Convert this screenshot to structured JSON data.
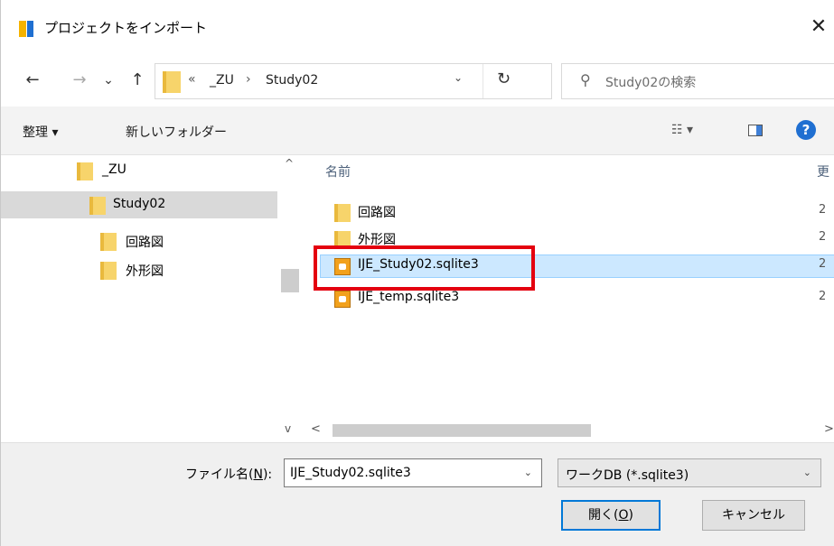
{
  "window": {
    "title": "プロジェクトをインポート",
    "close": "✕"
  },
  "nav": {
    "back": "←",
    "forward": "→",
    "recent": "⌄",
    "up": "↑"
  },
  "address": {
    "overflow": "«",
    "crumbs": [
      "_ZU",
      "Study02"
    ],
    "separator": "›",
    "dropdown": "⌄",
    "refresh": "↻"
  },
  "search": {
    "placeholder": "Study02の検索",
    "icon": "⚲"
  },
  "toolbar": {
    "organize": "整理 ▾",
    "new_folder": "新しいフォルダー",
    "view": "☷ ▾",
    "help": "?"
  },
  "tree": [
    {
      "label": "_ZU",
      "selected": false
    },
    {
      "label": "Study02",
      "selected": true
    },
    {
      "label": "回路図",
      "selected": false
    },
    {
      "label": "外形図",
      "selected": false
    }
  ],
  "tree_scroll": {
    "up": "^",
    "down": "v"
  },
  "list": {
    "columns": [
      "名前",
      "更"
    ],
    "rows": [
      {
        "name": "回路図",
        "type": "folder",
        "date_cut": "2",
        "selected": false
      },
      {
        "name": "外形図",
        "type": "folder",
        "date_cut": "2",
        "selected": false
      },
      {
        "name": "IJE_Study02.sqlite3",
        "type": "db",
        "date_cut": "2",
        "selected": true
      },
      {
        "name": "IJE_temp.sqlite3",
        "type": "db",
        "date_cut": "2",
        "selected": false
      }
    ],
    "hscroll": {
      "left": "<",
      "right": ">"
    }
  },
  "footer": {
    "filename_label_pre": "ファイル名(",
    "filename_label_key": "N",
    "filename_label_post": "):",
    "filename_value": "IJE_Study02.sqlite3",
    "filetype": "ワークDB (*.sqlite3)",
    "dropdown": "⌄",
    "open_pre": "開く(",
    "open_key": "O",
    "open_post": ")",
    "cancel": "キャンセル"
  },
  "colors": {
    "accent": "#0078d7",
    "highlight": "#e4000f",
    "selection": "#cce8ff"
  }
}
